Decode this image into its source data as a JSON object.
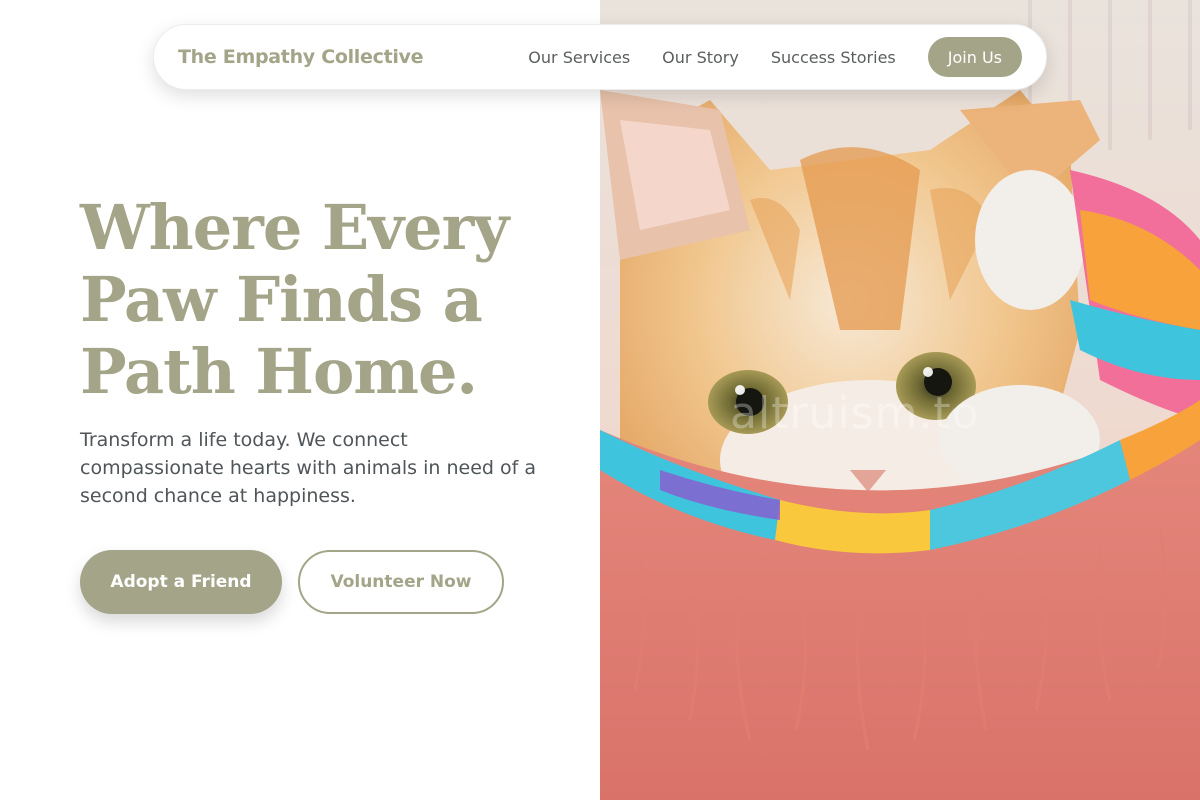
{
  "nav": {
    "brand": "The Empathy Collective",
    "links": [
      "Our Services",
      "Our Story",
      "Success Stories"
    ],
    "cta": "Join Us"
  },
  "hero": {
    "headline_lines": [
      "Where Every",
      "Paw Finds a",
      "Path Home."
    ],
    "subtext": "Transform a life today. We connect compassionate hearts with animals in need of a second chance at happiness.",
    "primary_button": "Adopt a Friend",
    "secondary_button": "Volunteer Now",
    "image_watermark": "altruism.to"
  },
  "colors": {
    "accent": "#a3a488",
    "text_body": "#4f5558",
    "nav_text": "#5b5f5c",
    "background": "#ffffff"
  }
}
